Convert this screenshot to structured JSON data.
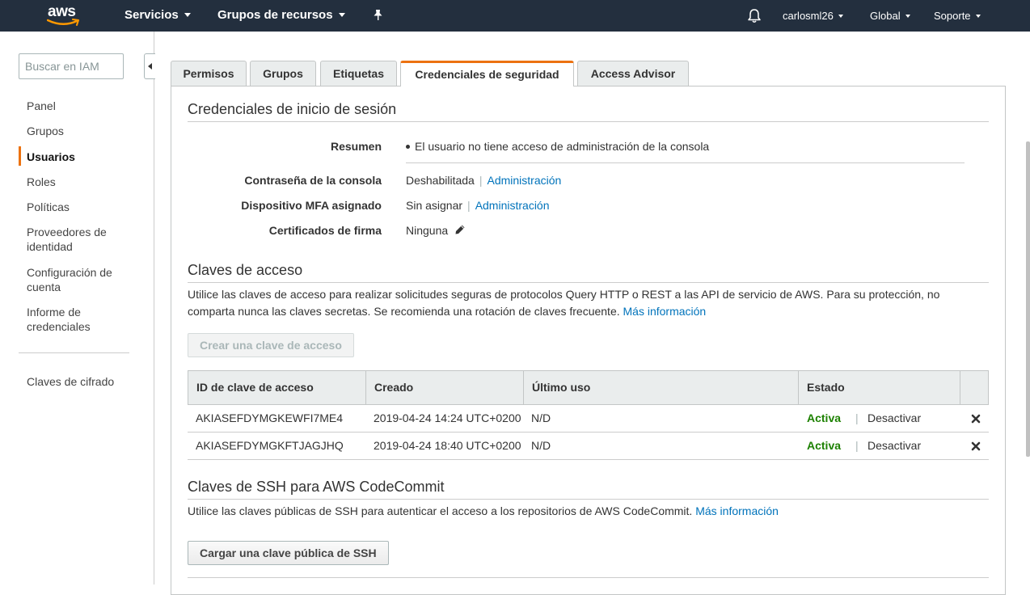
{
  "topnav": {
    "logo": "aws",
    "services": "Servicios",
    "resource_groups": "Grupos de recursos",
    "pin_icon": "pin-icon",
    "bell_icon": "bell-icon",
    "user": "carlosml26",
    "region": "Global",
    "support": "Soporte"
  },
  "sidebar": {
    "search_placeholder": "Buscar en IAM",
    "items": [
      {
        "label": "Panel"
      },
      {
        "label": "Grupos"
      },
      {
        "label": "Usuarios"
      },
      {
        "label": "Roles"
      },
      {
        "label": "Políticas"
      },
      {
        "label": "Proveedores de identidad"
      },
      {
        "label": "Configuración de cuenta"
      },
      {
        "label": "Informe de credenciales"
      }
    ],
    "extra_item": "Claves de cifrado",
    "active_item": "Usuarios"
  },
  "tabs": [
    {
      "label": "Permisos"
    },
    {
      "label": "Grupos"
    },
    {
      "label": "Etiquetas"
    },
    {
      "label": "Credenciales de seguridad"
    },
    {
      "label": "Access Advisor"
    }
  ],
  "signin": {
    "title": "Credenciales de inicio de sesión",
    "summary_label": "Resumen",
    "summary_value": "El usuario no tiene acceso de administración de la consola",
    "password_label": "Contraseña de la consola",
    "password_value": "Deshabilitada",
    "password_link": "Administración",
    "mfa_label": "Dispositivo MFA asignado",
    "mfa_value": "Sin asignar",
    "mfa_link": "Administración",
    "certs_label": "Certificados de firma",
    "certs_value": "Ninguna",
    "edit_icon": "pencil-icon"
  },
  "access_keys": {
    "title": "Claves de acceso",
    "description": "Utilice las claves de acceso para realizar solicitudes seguras de protocolos Query HTTP o REST a las API de servicio de AWS. Para su protección, no comparta nunca las claves secretas. Se recomienda una rotación de claves frecuente.",
    "more_info": "Más información",
    "create_button": "Crear una clave de acceso",
    "columns": [
      "ID de clave de acceso",
      "Creado",
      "Último uso",
      "Estado",
      ""
    ],
    "rows": [
      {
        "id": "AKIASEFDYMGKEWFI7ME4",
        "created": "2019-04-24 14:24 UTC+0200",
        "last_used": "N/D",
        "status": "Activa",
        "action": "Desactivar"
      },
      {
        "id": "AKIASEFDYMGKFTJAGJHQ",
        "created": "2019-04-24 18:40 UTC+0200",
        "last_used": "N/D",
        "status": "Activa",
        "action": "Desactivar"
      }
    ],
    "status_color": "#1d8102"
  },
  "ssh": {
    "title": "Claves de SSH para AWS CodeCommit",
    "description": "Utilice las claves públicas de SSH para autenticar el acceso a los repositorios de AWS CodeCommit.",
    "more_info": "Más información",
    "upload_button": "Cargar una clave pública de SSH"
  },
  "colors": {
    "nav_bg": "#232f3e",
    "accent": "#ec7211",
    "link": "#0073bb"
  }
}
